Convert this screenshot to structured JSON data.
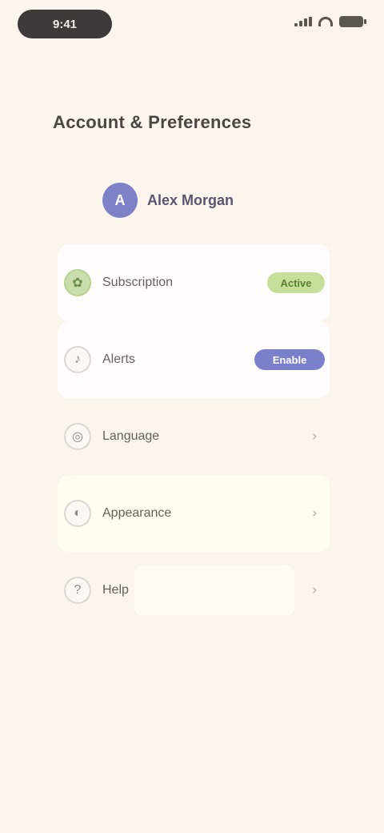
{
  "status_bar": {
    "time": "9:41"
  },
  "title": "Account & Preferences",
  "profile": {
    "initial": "A",
    "name": "Alex Morgan"
  },
  "rows": [
    {
      "label": "Subscription",
      "icon": "leaf-icon",
      "control": "Active"
    },
    {
      "label": "Alerts",
      "icon": "bell-icon",
      "control": "Enable"
    },
    {
      "label": "Language",
      "icon": "globe-icon",
      "chevron": "›"
    },
    {
      "label": "Appearance",
      "icon": "palette-icon",
      "chevron": "›"
    },
    {
      "label": "Help",
      "icon": "help-icon",
      "chevron": "›"
    }
  ],
  "colors": {
    "background": "#fbf5ee",
    "accent": "#7b80cc",
    "positive": "#c6e09b"
  }
}
